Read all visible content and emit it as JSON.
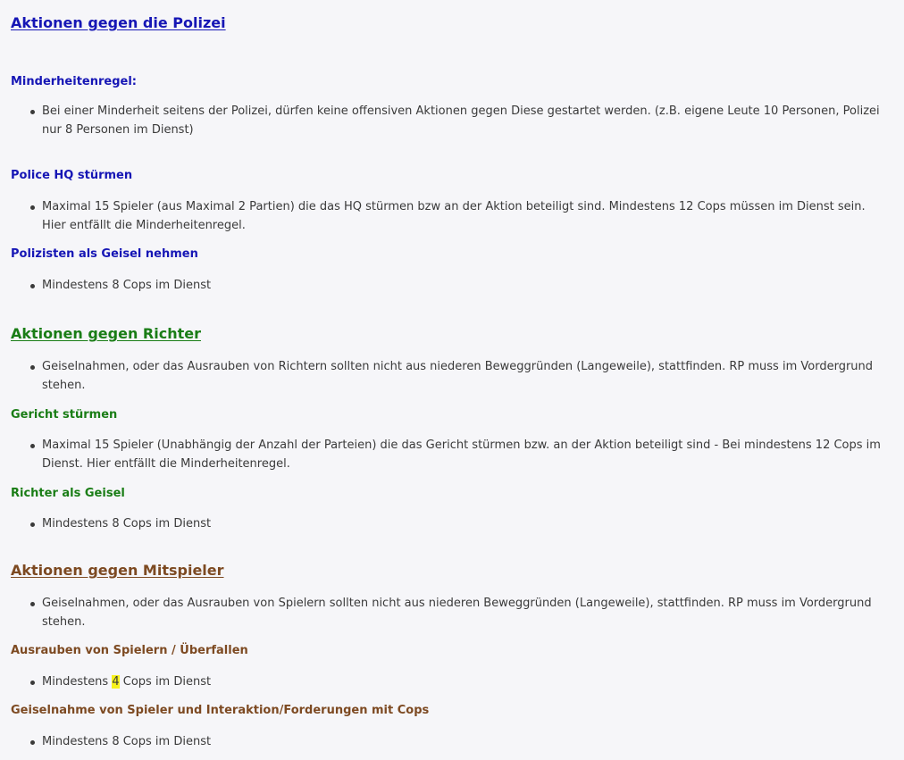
{
  "sections": {
    "polizei": {
      "title": "Aktionen gegen die Polizei",
      "minderheit_heading": "Minderheitenregel:",
      "minderheit_item": "Bei einer Minderheit seitens der Polizei, dürfen keine offensiven Aktionen gegen Diese gestartet werden. (z.B. eigene Leute 10 Personen, Polizei nur 8 Personen im Dienst)",
      "hq_heading": "Police HQ stürmen",
      "hq_item": "Maximal 15 Spieler (aus Maximal 2 Partien) die das HQ stürmen bzw an der Aktion beteiligt sind. Mindestens 12 Cops müssen im Dienst sein. Hier entfällt die Minderheitenregel.",
      "geisel_heading": "Polizisten als Geisel nehmen",
      "geisel_item": "Mindestens 8 Cops im Dienst",
      "color": "#1616b5"
    },
    "richter": {
      "title": "Aktionen gegen Richter",
      "intro_item": "Geiselnahmen, oder das Ausrauben von Richtern sollten nicht aus niederen Beweggründen (Langeweile), stattfinden. RP muss im Vordergrund stehen.",
      "gericht_heading": "Gericht stürmen",
      "gericht_item": "Maximal 15 Spieler (Unabhängig der Anzahl der Parteien) die das Gericht stürmen bzw. an der Aktion beteiligt sind - Bei mindestens 12 Cops im Dienst. Hier entfällt die Minderheitenregel.",
      "geisel_heading": "Richter als Geisel",
      "geisel_item": "Mindestens 8 Cops im Dienst",
      "color": "#1a7d16"
    },
    "mitspieler": {
      "title": "Aktionen gegen Mitspieler",
      "intro_item": "Geiselnahmen, oder das Ausrauben von Spielern sollten nicht aus niederen Beweggründen (Langeweile), stattfinden. RP muss im Vordergrund stehen.",
      "ausrauben_heading": "Ausrauben von Spielern / Überfallen",
      "ausrauben_item_pre": "Mindestens ",
      "ausrauben_item_num": "4",
      "ausrauben_item_post": " Cops im Dienst",
      "geisel_heading": "Geiselnahme von Spieler und Interaktion/Forderungen mit Cops",
      "geisel_item": "Mindestens 8 Cops im Dienst",
      "color": "#7d4a22",
      "highlight_color": "#f7f21a"
    }
  }
}
